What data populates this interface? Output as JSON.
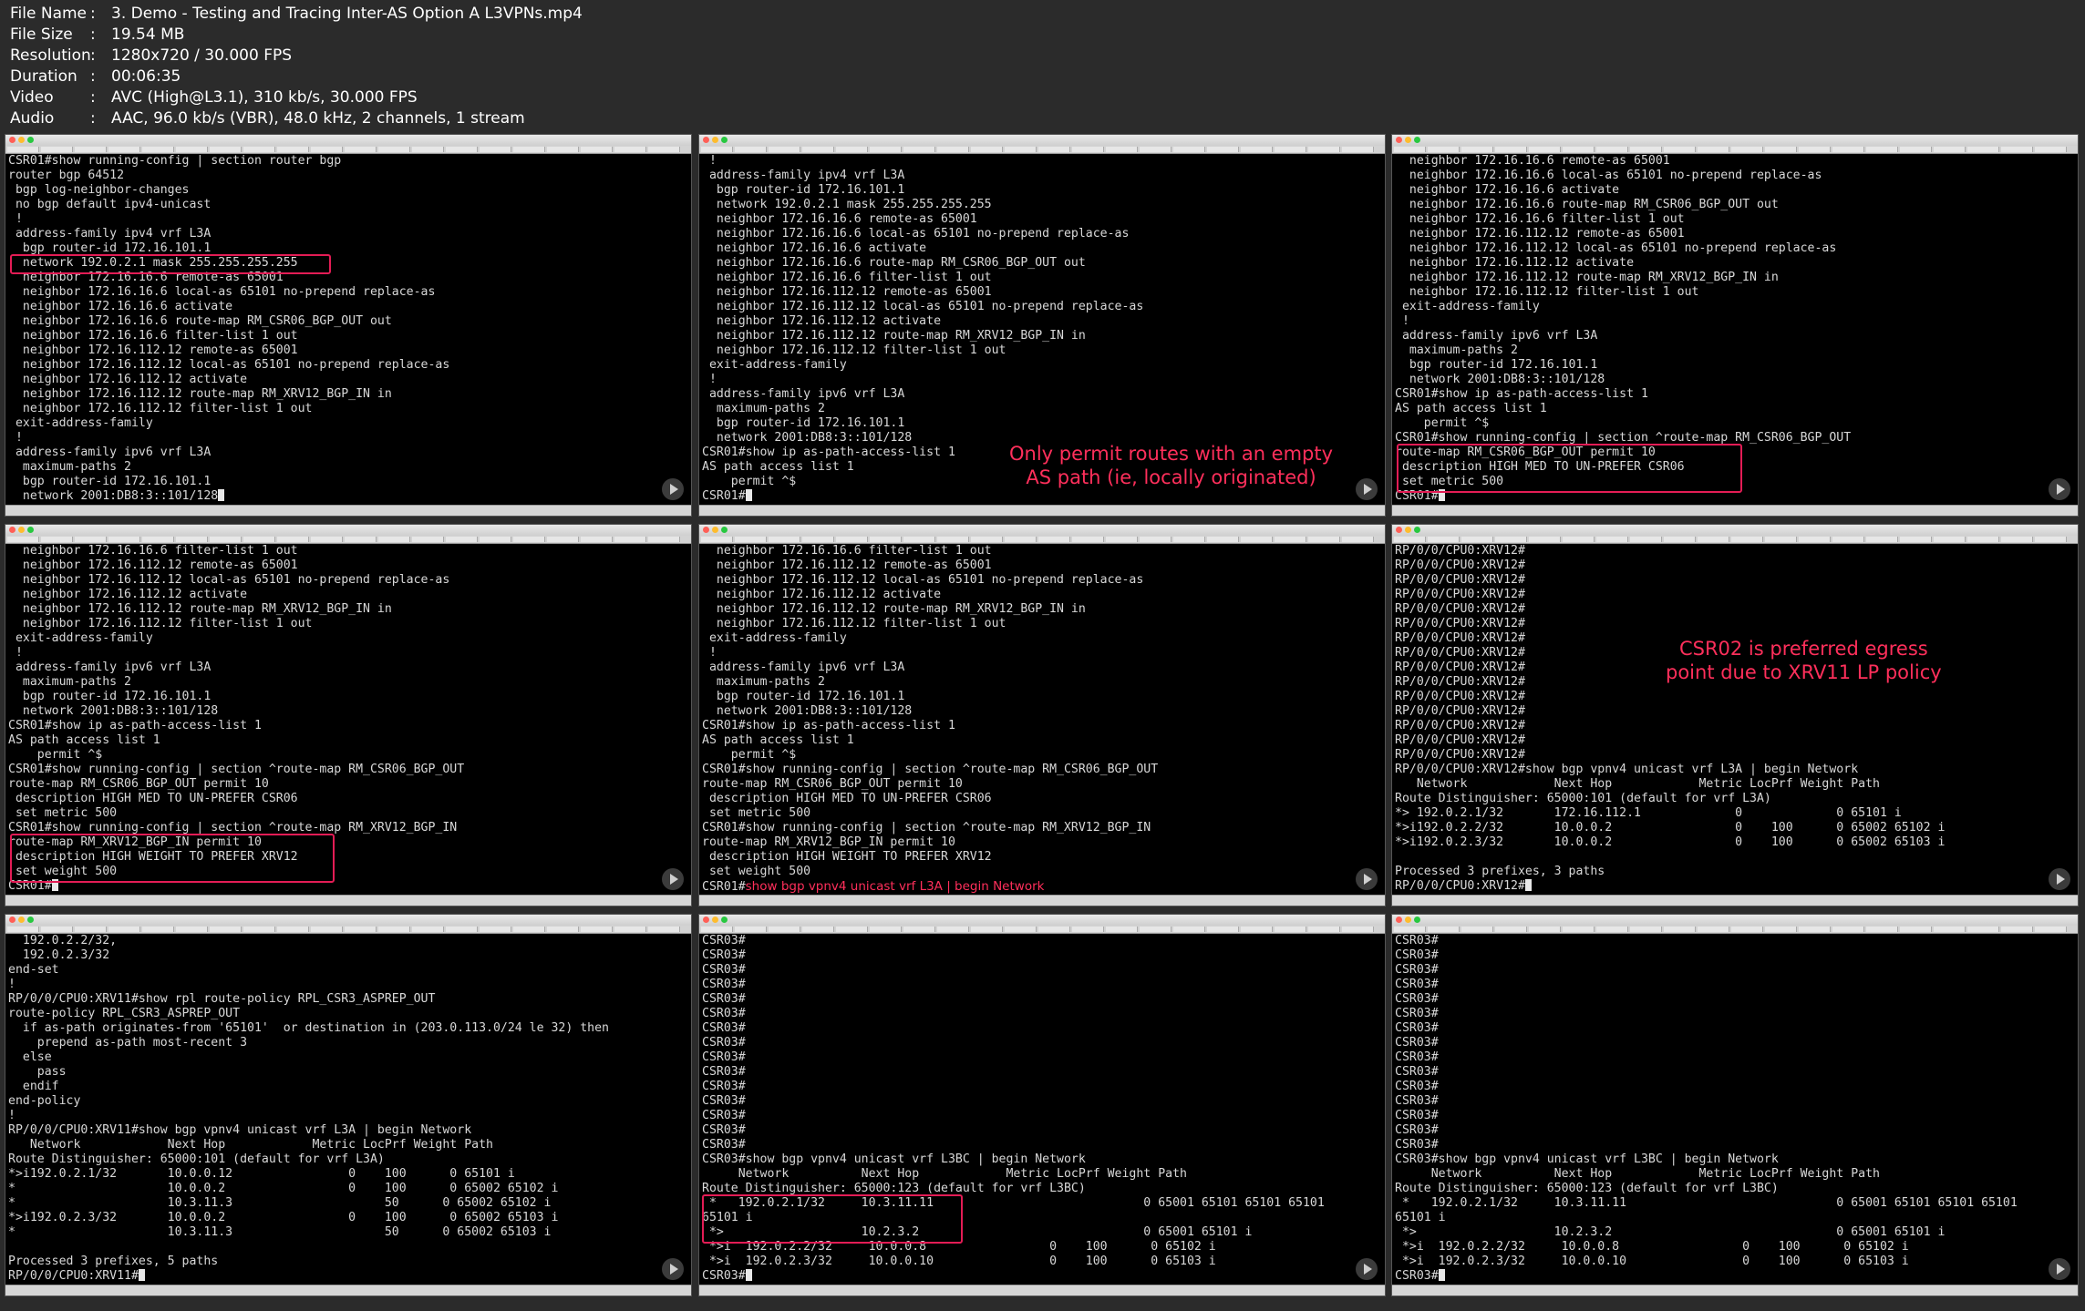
{
  "header": {
    "colon": ":",
    "rows": [
      {
        "key": "File Name",
        "value": "3. Demo - Testing and Tracing Inter-AS Option A L3VPNs.mp4"
      },
      {
        "key": "File Size",
        "value": "19.54 MB"
      },
      {
        "key": "Resolution",
        "value": "1280x720 / 30.000 FPS"
      },
      {
        "key": "Duration",
        "value": "00:06:35"
      },
      {
        "key": "Video",
        "value": "AVC (High@L3.1), 310 kb/s, 30.000 FPS"
      },
      {
        "key": "Audio",
        "value": "AAC, 96.0 kb/s (VBR), 48.0 kHz, 2 channels, 1 stream"
      }
    ]
  },
  "panels": [
    {
      "lines": [
        "CSR01#show running-config | section router bgp",
        "router bgp 64512",
        " bgp log-neighbor-changes",
        " no bgp default ipv4-unicast",
        " !",
        " address-family ipv4 vrf L3A",
        "  bgp router-id 172.16.101.1",
        "  network 192.0.2.1 mask 255.255.255.255",
        "  neighbor 172.16.16.6 remote-as 65001",
        "  neighbor 172.16.16.6 local-as 65101 no-prepend replace-as",
        "  neighbor 172.16.16.6 activate",
        "  neighbor 172.16.16.6 route-map RM_CSR06_BGP_OUT out",
        "  neighbor 172.16.16.6 filter-list 1 out",
        "  neighbor 172.16.112.12 remote-as 65001",
        "  neighbor 172.16.112.12 local-as 65101 no-prepend replace-as",
        "  neighbor 172.16.112.12 activate",
        "  neighbor 172.16.112.12 route-map RM_XRV12_BGP_IN in",
        "  neighbor 172.16.112.12 filter-list 1 out",
        " exit-address-family",
        " !",
        " address-family ipv6 vrf L3A",
        "  maximum-paths 2",
        "  bgp router-id 172.16.101.1",
        "  network 2001:DB8:3::101/128"
      ]
    },
    {
      "lines": [
        " !",
        " address-family ipv4 vrf L3A",
        "  bgp router-id 172.16.101.1",
        "  network 192.0.2.1 mask 255.255.255.255",
        "  neighbor 172.16.16.6 remote-as 65001",
        "  neighbor 172.16.16.6 local-as 65101 no-prepend replace-as",
        "  neighbor 172.16.16.6 activate",
        "  neighbor 172.16.16.6 route-map RM_CSR06_BGP_OUT out",
        "  neighbor 172.16.16.6 filter-list 1 out",
        "  neighbor 172.16.112.12 remote-as 65001",
        "  neighbor 172.16.112.12 local-as 65101 no-prepend replace-as",
        "  neighbor 172.16.112.12 activate",
        "  neighbor 172.16.112.12 route-map RM_XRV12_BGP_IN in",
        "  neighbor 172.16.112.12 filter-list 1 out",
        " exit-address-family",
        " !",
        " address-family ipv6 vrf L3A",
        "  maximum-paths 2",
        "  bgp router-id 172.16.101.1",
        "  network 2001:DB8:3::101/128",
        "CSR01#show ip as-path-access-list 1",
        "AS path access list 1",
        "    permit ^$",
        "CSR01#"
      ],
      "note": "Only permit routes with an empty\nAS path (ie, locally originated)"
    },
    {
      "lines": [
        "  neighbor 172.16.16.6 remote-as 65001",
        "  neighbor 172.16.16.6 local-as 65101 no-prepend replace-as",
        "  neighbor 172.16.16.6 activate",
        "  neighbor 172.16.16.6 route-map RM_CSR06_BGP_OUT out",
        "  neighbor 172.16.16.6 filter-list 1 out",
        "  neighbor 172.16.112.12 remote-as 65001",
        "  neighbor 172.16.112.12 local-as 65101 no-prepend replace-as",
        "  neighbor 172.16.112.12 activate",
        "  neighbor 172.16.112.12 route-map RM_XRV12_BGP_IN in",
        "  neighbor 172.16.112.12 filter-list 1 out",
        " exit-address-family",
        " !",
        " address-family ipv6 vrf L3A",
        "  maximum-paths 2",
        "  bgp router-id 172.16.101.1",
        "  network 2001:DB8:3::101/128",
        "CSR01#show ip as-path-access-list 1",
        "AS path access list 1",
        "    permit ^$",
        "CSR01#show running-config | section ^route-map RM_CSR06_BGP_OUT",
        "route-map RM_CSR06_BGP_OUT permit 10",
        " description HIGH MED TO UN-PREFER CSR06",
        " set metric 500",
        "CSR01#"
      ]
    },
    {
      "lines": [
        "  neighbor 172.16.16.6 filter-list 1 out",
        "  neighbor 172.16.112.12 remote-as 65001",
        "  neighbor 172.16.112.12 local-as 65101 no-prepend replace-as",
        "  neighbor 172.16.112.12 activate",
        "  neighbor 172.16.112.12 route-map RM_XRV12_BGP_IN in",
        "  neighbor 172.16.112.12 filter-list 1 out",
        " exit-address-family",
        " !",
        " address-family ipv6 vrf L3A",
        "  maximum-paths 2",
        "  bgp router-id 172.16.101.1",
        "  network 2001:DB8:3::101/128",
        "CSR01#show ip as-path-access-list 1",
        "AS path access list 1",
        "    permit ^$",
        "CSR01#show running-config | section ^route-map RM_CSR06_BGP_OUT",
        "route-map RM_CSR06_BGP_OUT permit 10",
        " description HIGH MED TO UN-PREFER CSR06",
        " set metric 500",
        "CSR01#show running-config | section ^route-map RM_XRV12_BGP_IN",
        "route-map RM_XRV12_BGP_IN permit 10",
        " description HIGH WEIGHT TO PREFER XRV12",
        " set weight 500",
        "CSR01#"
      ]
    },
    {
      "lines": [
        "  neighbor 172.16.16.6 filter-list 1 out",
        "  neighbor 172.16.112.12 remote-as 65001",
        "  neighbor 172.16.112.12 local-as 65101 no-prepend replace-as",
        "  neighbor 172.16.112.12 activate",
        "  neighbor 172.16.112.12 route-map RM_XRV12_BGP_IN in",
        "  neighbor 172.16.112.12 filter-list 1 out",
        " exit-address-family",
        " !",
        " address-family ipv6 vrf L3A",
        "  maximum-paths 2",
        "  bgp router-id 172.16.101.1",
        "  network 2001:DB8:3::101/128",
        "CSR01#show ip as-path-access-list 1",
        "AS path access list 1",
        "    permit ^$",
        "CSR01#show running-config | section ^route-map RM_CSR06_BGP_OUT",
        "route-map RM_CSR06_BGP_OUT permit 10",
        " description HIGH MED TO UN-PREFER CSR06",
        " set metric 500",
        "CSR01#show running-config | section ^route-map RM_XRV12_BGP_IN",
        "route-map RM_XRV12_BGP_IN permit 10",
        " description HIGH WEIGHT TO PREFER XRV12",
        " set weight 500",
        "CSR01#"
      ],
      "inline_note": "show bgp vpnv4 unicast vrf L3A | begin Network"
    },
    {
      "lines": [
        "RP/0/0/CPU0:XRV12#",
        "RP/0/0/CPU0:XRV12#",
        "RP/0/0/CPU0:XRV12#",
        "RP/0/0/CPU0:XRV12#",
        "RP/0/0/CPU0:XRV12#",
        "RP/0/0/CPU0:XRV12#",
        "RP/0/0/CPU0:XRV12#",
        "RP/0/0/CPU0:XRV12#",
        "RP/0/0/CPU0:XRV12#",
        "RP/0/0/CPU0:XRV12#",
        "RP/0/0/CPU0:XRV12#",
        "RP/0/0/CPU0:XRV12#",
        "RP/0/0/CPU0:XRV12#",
        "RP/0/0/CPU0:XRV12#",
        "RP/0/0/CPU0:XRV12#",
        "RP/0/0/CPU0:XRV12#show bgp vpnv4 unicast vrf L3A | begin Network",
        "   Network            Next Hop            Metric LocPrf Weight Path",
        "Route Distinguisher: 65000:101 (default for vrf L3A)",
        "*> 192.0.2.1/32       172.16.112.1             0             0 65101 i",
        "*>i192.0.2.2/32       10.0.0.2                 0    100      0 65002 65102 i",
        "*>i192.0.2.3/32       10.0.0.2                 0    100      0 65002 65103 i",
        "",
        "Processed 3 prefixes, 3 paths",
        "RP/0/0/CPU0:XRV12#"
      ],
      "note": "CSR02 is preferred egress\npoint due to XRV11 LP policy"
    },
    {
      "lines": [
        "  192.0.2.2/32,",
        "  192.0.2.3/32",
        "end-set",
        "!",
        "RP/0/0/CPU0:XRV11#show rpl route-policy RPL_CSR3_ASPREP_OUT",
        "route-policy RPL_CSR3_ASPREP_OUT",
        "  if as-path originates-from '65101'  or destination in (203.0.113.0/24 le 32) then",
        "    prepend as-path most-recent 3",
        "  else",
        "    pass",
        "  endif",
        "end-policy",
        "!",
        "RP/0/0/CPU0:XRV11#show bgp vpnv4 unicast vrf L3A | begin Network",
        "   Network            Next Hop            Metric LocPrf Weight Path",
        "Route Distinguisher: 65000:101 (default for vrf L3A)",
        "*>i192.0.2.1/32       10.0.0.12                0    100      0 65101 i",
        "*                     10.0.0.2                 0    100      0 65002 65102 i",
        "*                     10.3.11.3                     50      0 65002 65102 i",
        "*>i192.0.2.3/32       10.0.0.2                 0    100      0 65002 65103 i",
        "*                     10.3.11.3                     50      0 65002 65103 i",
        "",
        "Processed 3 prefixes, 5 paths",
        "RP/0/0/CPU0:XRV11#"
      ]
    },
    {
      "lines": [
        "CSR03#",
        "CSR03#",
        "CSR03#",
        "CSR03#",
        "CSR03#",
        "CSR03#",
        "CSR03#",
        "CSR03#",
        "CSR03#",
        "CSR03#",
        "CSR03#",
        "CSR03#",
        "CSR03#",
        "CSR03#",
        "CSR03#",
        "CSR03#show bgp vpnv4 unicast vrf L3BC | begin Network",
        "     Network          Next Hop            Metric LocPrf Weight Path",
        "Route Distinguisher: 65000:123 (default for vrf L3BC)",
        " *   192.0.2.1/32     10.3.11.11                             0 65001 65101 65101 65101",
        "65101 i",
        " *>                   10.2.3.2                               0 65001 65101 i",
        " *>i  192.0.2.2/32     10.0.0.8                 0    100      0 65102 i",
        " *>i  192.0.2.3/32     10.0.0.10                0    100      0 65103 i",
        "CSR03#"
      ]
    },
    {
      "lines": [
        "CSR03#",
        "CSR03#",
        "CSR03#",
        "CSR03#",
        "CSR03#",
        "CSR03#",
        "CSR03#",
        "CSR03#",
        "CSR03#",
        "CSR03#",
        "CSR03#",
        "CSR03#",
        "CSR03#",
        "CSR03#",
        "CSR03#",
        "CSR03#show bgp vpnv4 unicast vrf L3BC | begin Network",
        "     Network          Next Hop            Metric LocPrf Weight Path",
        "Route Distinguisher: 65000:123 (default for vrf L3BC)",
        " *   192.0.2.1/32     10.3.11.11                             0 65001 65101 65101 65101",
        "65101 i",
        " *>                   10.2.3.2                               0 65001 65101 i",
        " *>i  192.0.2.2/32     10.0.0.8                 0    100      0 65102 i",
        " *>i  192.0.2.3/32     10.0.0.10                0    100      0 65103 i",
        "CSR03#"
      ]
    }
  ],
  "colors": {
    "background": "#2b2b2b",
    "terminal_bg": "#000000",
    "terminal_text": "#d8d8d8",
    "highlight": "#e31c55",
    "annotation": "#ff2f5b"
  }
}
